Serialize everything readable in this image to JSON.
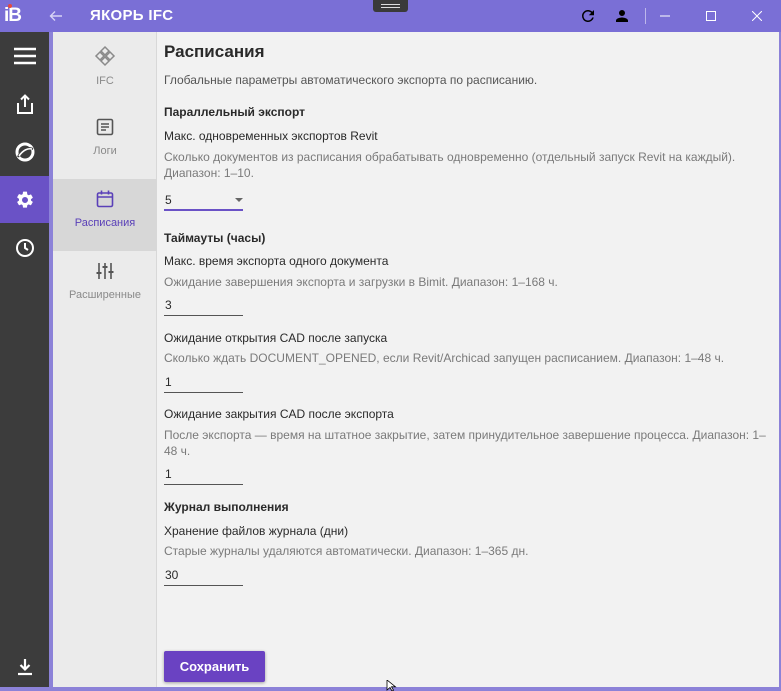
{
  "app": {
    "logo_text": "iB",
    "title": "ЯКОРЬ IFC"
  },
  "icons": {
    "back": "arrow-left-icon",
    "refresh": "refresh-icon",
    "account": "account-icon",
    "minimize": "minimize-icon",
    "maximize": "maximize-icon",
    "close": "close-icon"
  },
  "sidebar": {
    "items": [
      {
        "icon": "menu-icon"
      },
      {
        "icon": "share-icon"
      },
      {
        "icon": "brand-ring-icon"
      },
      {
        "icon": "gear-icon",
        "active": true
      },
      {
        "icon": "clock-icon"
      },
      {
        "icon": "download-icon"
      }
    ]
  },
  "subnav": {
    "items": [
      {
        "label": "IFC",
        "icon": "ifc-icon"
      },
      {
        "label": "Логи",
        "icon": "document-icon"
      },
      {
        "label": "Расписания",
        "icon": "calendar-icon",
        "active": true
      },
      {
        "label": "Расширенные",
        "icon": "tune-icon"
      }
    ]
  },
  "page": {
    "title": "Расписания",
    "description": "Глобальные параметры автоматического экспорта по расписанию."
  },
  "sections": {
    "parallel": {
      "heading": "Параллельный экспорт",
      "max_exports": {
        "label": "Макс. одновременных экспортов Revit",
        "hint": "Сколько документов из расписания обрабатывать одновременно (отдельный запуск Revit на каждый). Диапазон: 1–10.",
        "value": "5"
      }
    },
    "timeouts": {
      "heading": "Таймауты (часы)",
      "export_time": {
        "label": "Макс. время экспорта одного документа",
        "hint": "Ожидание завершения экспорта и загрузки в Bimit. Диапазон: 1–168 ч.",
        "value": "3"
      },
      "cad_open": {
        "label": "Ожидание открытия CAD после запуска",
        "hint": "Сколько ждать DOCUMENT_OPENED, если Revit/Archicad запущен расписанием. Диапазон: 1–48 ч.",
        "value": "1"
      },
      "cad_close": {
        "label": "Ожидание закрытия CAD после экспорта",
        "hint": "После экспорта — время на штатное закрытие, затем принудительное завершение процесса. Диапазон: 1–48 ч.",
        "value": "1"
      }
    },
    "journal": {
      "heading": "Журнал выполнения",
      "retention": {
        "label": "Хранение файлов журнала (дни)",
        "hint": "Старые журналы удаляются автоматически. Диапазон: 1–365 дн.",
        "value": "30"
      }
    }
  },
  "actions": {
    "save_label": "Сохранить"
  }
}
